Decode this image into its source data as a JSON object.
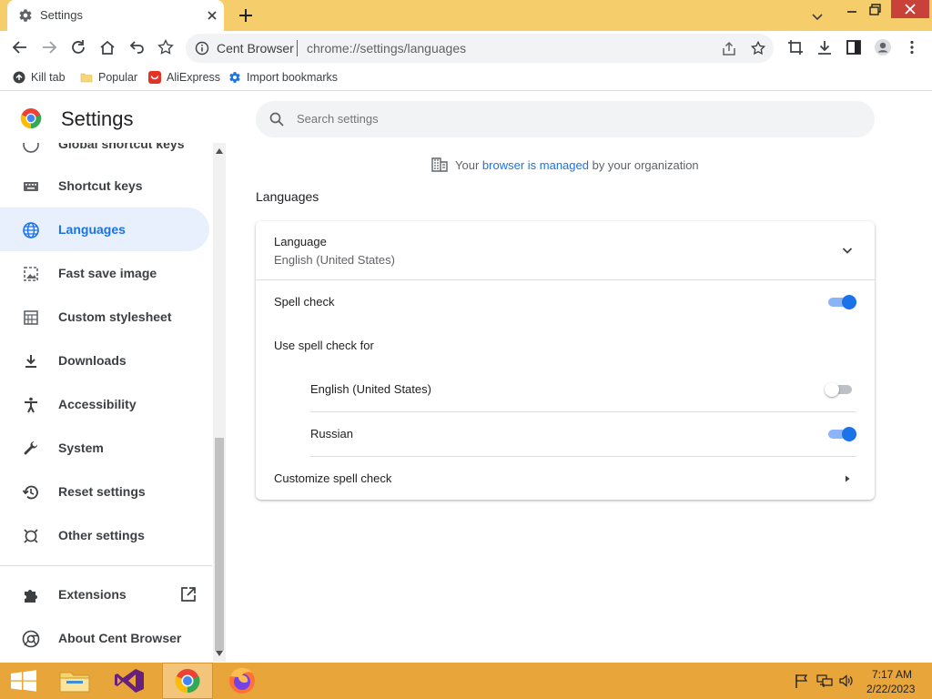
{
  "tab": {
    "title": "Settings"
  },
  "omnibox": {
    "site": "Cent Browser",
    "url": "chrome://settings/languages"
  },
  "bookmarks": [
    {
      "label": "Kill tab"
    },
    {
      "label": "Popular"
    },
    {
      "label": "AliExpress"
    },
    {
      "label": "Import bookmarks"
    }
  ],
  "header": {
    "title": "Settings",
    "search_placeholder": "Search settings"
  },
  "sidebar": {
    "items": [
      {
        "label": "Global shortcut keys",
        "icon": "keyboard-icon"
      },
      {
        "label": "Shortcut keys",
        "icon": "keyboard-icon"
      },
      {
        "label": "Languages",
        "icon": "globe-icon",
        "active": true
      },
      {
        "label": "Fast save image",
        "icon": "image-icon"
      },
      {
        "label": "Custom stylesheet",
        "icon": "stylesheet-icon"
      },
      {
        "label": "Downloads",
        "icon": "download-icon"
      },
      {
        "label": "Accessibility",
        "icon": "accessibility-icon"
      },
      {
        "label": "System",
        "icon": "wrench-icon"
      },
      {
        "label": "Reset settings",
        "icon": "restore-icon"
      },
      {
        "label": "Other settings",
        "icon": "other-icon"
      }
    ],
    "extensions_label": "Extensions",
    "about_label": "About Cent Browser"
  },
  "managed": {
    "prefix": "Your",
    "link": "browser is managed",
    "suffix": "by your organization"
  },
  "languages": {
    "heading": "Languages",
    "language_label": "Language",
    "language_value": "English (United States)",
    "spell_check_label": "Spell check",
    "spell_check_on": true,
    "use_for_label": "Use spell check for",
    "languages": [
      {
        "name": "English (United States)",
        "enabled": false
      },
      {
        "name": "Russian",
        "enabled": true
      }
    ],
    "customize_label": "Customize spell check"
  },
  "taskbar": {
    "time": "7:17 AM",
    "date": "2/22/2023"
  },
  "colors": {
    "accent": "#1a73e8",
    "tabstrip": "#f5cd6b",
    "taskbar": "#e8a53a"
  }
}
